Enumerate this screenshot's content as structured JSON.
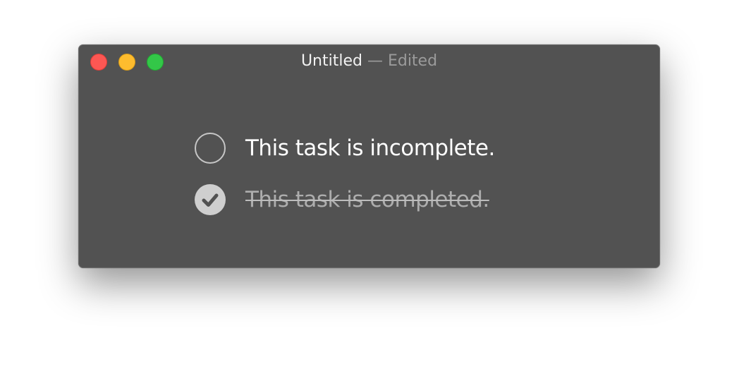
{
  "window": {
    "title": "Untitled",
    "status": " — Edited"
  },
  "tasks": [
    {
      "label": "This task is incomplete.",
      "done": false
    },
    {
      "label": "This task is completed.",
      "done": true
    }
  ],
  "colors": {
    "window_bg": "#525252",
    "close": "#fc5753",
    "minimize": "#fdbc2e",
    "zoom": "#33c748"
  },
  "icons": {
    "incomplete": "empty-circle-checkbox-icon",
    "completed": "checkmark-circle-icon"
  }
}
